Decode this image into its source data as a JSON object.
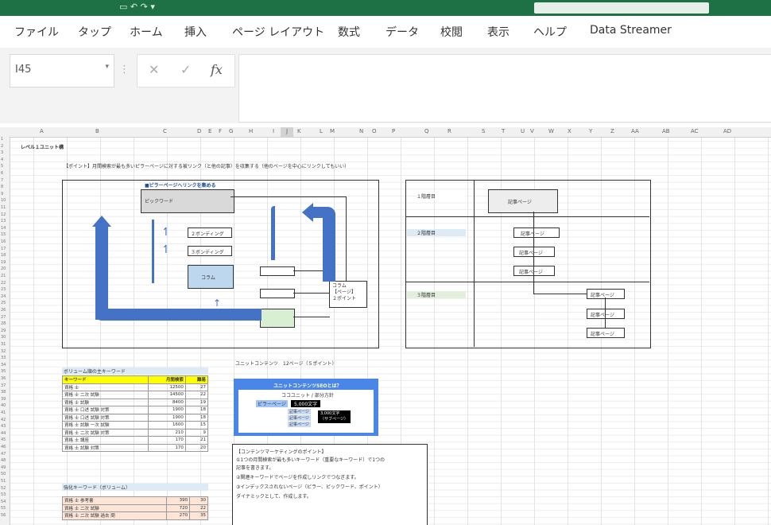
{
  "ribbon": {
    "tabs": [
      "ファイル",
      "タップ",
      "ホーム",
      "挿入",
      "ページ レイアウト",
      "数式",
      "データ",
      "校閲",
      "表示",
      "ヘルプ",
      "Data Streamer"
    ]
  },
  "formula_bar": {
    "name_box": "I45",
    "cancel_glyph": "✕",
    "enter_glyph": "✓",
    "fx_label": "fx"
  },
  "sheet": {
    "columns": [
      "A",
      "B",
      "C",
      "D",
      "E",
      "F",
      "G",
      "H",
      "I",
      "J",
      "K",
      "L",
      "M",
      "N",
      "O",
      "P",
      "Q",
      "R",
      "S",
      "T",
      "U",
      "V",
      "W",
      "X",
      "Y",
      "Z",
      "AA",
      "AB",
      "AC",
      "AD"
    ],
    "rows": [
      "1",
      "2",
      "3",
      "4",
      "5",
      "6",
      "7",
      "8",
      "9",
      "10",
      "11",
      "12",
      "13",
      "14",
      "15",
      "16",
      "17",
      "18",
      "19",
      "20",
      "21",
      "22",
      "23",
      "24",
      "25",
      "26",
      "27",
      "28",
      "29",
      "30",
      "31",
      "32",
      "33",
      "34",
      "35",
      "36",
      "37",
      "38",
      "39",
      "40",
      "41",
      "42",
      "43",
      "44",
      "45",
      "46",
      "47",
      "48",
      "49",
      "50",
      "51",
      "52",
      "53",
      "54",
      "55",
      "56"
    ],
    "title": "レベル１ユニット構",
    "point_note": "【ポイント】月間検索が最も多いピラーページに対する被リンク（と他の記事）を収集する（他のページを中心にリンクしてもいい）",
    "left_diagram": {
      "heading": "■ピラーページへリンクを集める",
      "pillar_label": "ピックワード",
      "box2": "２ボンディング",
      "box3": "３ボンディング",
      "box4": "コラム",
      "mid1": "",
      "mid2": "",
      "mid3": "",
      "column_box": "コラム\n【ページ】\n２ポイント"
    },
    "right_diagram": {
      "row1": "１階層目",
      "row2": "２階層目",
      "row3": "３階層目",
      "top_box": "記事ページ",
      "mid_boxes": [
        "記事ページ",
        "記事ページ",
        "記事ページ"
      ],
      "low_boxes": [
        "記事ページ",
        "記事ページ",
        "記事ページ"
      ]
    },
    "kw_table": {
      "caption": "ボリューム順の主キーワード",
      "headers": [
        "キーワード",
        "月間検索",
        "難易"
      ],
      "rows": [
        [
          "資格 士",
          "12500",
          "27"
        ],
        [
          "資格 士 二次 試験",
          "14500",
          "22"
        ],
        [
          "資格 士 試験",
          "8400",
          "19"
        ],
        [
          "資格 士 口述 試験 対策",
          "1900",
          "18"
        ],
        [
          "資格 士 口述 試験 対策",
          "1900",
          "18"
        ],
        [
          "資格 士 試験 一次 試験",
          "1600",
          "15"
        ],
        [
          "資格 士 二次 試験 対策",
          "210",
          "9"
        ],
        [
          "資格 士 講座",
          "170",
          "21"
        ],
        [
          "資格 士 試験 対策",
          "170",
          "20"
        ]
      ]
    },
    "kw_table2": {
      "caption": "強化キーワード（ボリューム）",
      "rows": [
        [
          "資格 士 参考書",
          "390",
          "30"
        ],
        [
          "資格 士 二次 試験",
          "720",
          "22"
        ],
        [
          "資格 士 二次 試験 過去 問",
          "270",
          "35"
        ]
      ]
    },
    "unit_note": "ユニットコンテンツ　12ページ（５ポイント）",
    "unit_box": {
      "title": "ユニットコンテンツSEOとは？",
      "subtitle": "ココユニット / 部分方針",
      "pillar": "ピラーページ",
      "pillar_tag": "5,000文字",
      "sub_labels": [
        "記事ページ",
        "記事ページ",
        "記事ページ"
      ],
      "sub_tag": "3,000文字\n（サブページ）"
    },
    "content_note": {
      "lines": [
        "【コンテンツマーケティングのポイント】",
        "①1つの月間検索が最も多いキーワード（重要なキーワード）で1つの",
        "記事を書きます。",
        "②関連キーワードでページを作成しリンクでつなぎます。",
        "③インデックスされないページ（ピラー、ピックワード、ポイント）",
        "ダイナミックとして、作成します。"
      ]
    }
  }
}
